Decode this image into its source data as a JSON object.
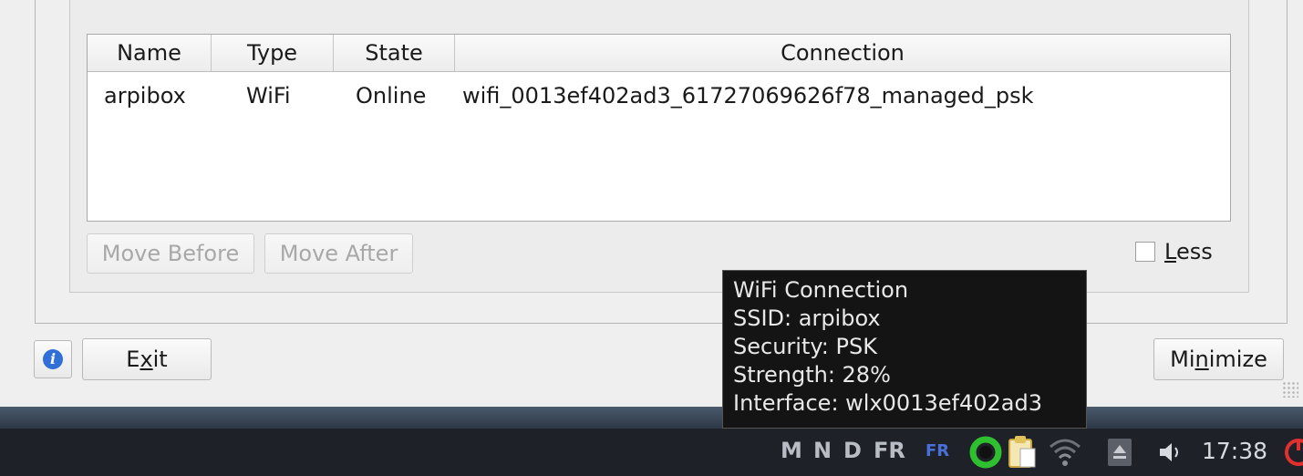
{
  "table": {
    "columns": [
      "Name",
      "Type",
      "State",
      "Connection"
    ],
    "rows": [
      {
        "name": "arpibox",
        "type": "WiFi",
        "state": "Online",
        "connection": "wifi_0013ef402ad3_61727069626f78_managed_psk"
      }
    ]
  },
  "buttons": {
    "move_before": "Move Before",
    "move_after": "Move After",
    "less_label_pre": "",
    "less_label_mnemonic": "L",
    "less_label_post": "ess",
    "less_checked": false,
    "exit_pre": "E",
    "exit_mnemonic": "x",
    "exit_post": "it",
    "minimize_pre": "Mi",
    "minimize_mnemonic": "n",
    "minimize_post": "imize"
  },
  "tooltip": {
    "lines": [
      "WiFi Connection",
      "SSID: arpibox",
      "Security: PSK",
      "Strength: 28%",
      "Interface: wlx0013ef402ad3"
    ]
  },
  "taskbar": {
    "indicators": [
      "M",
      "N",
      "D",
      "FR"
    ],
    "keyboard_layout": "FR",
    "clock": "17:38",
    "icons": [
      "green-ring-icon",
      "clipboard-icon",
      "wifi-icon",
      "eject-icon",
      "volume-icon",
      "shutdown-icon"
    ]
  },
  "colors": {
    "tooltip_bg": "#141414",
    "taskbar_bg": "#1e2127",
    "layout_blue": "#4a6fd8",
    "green": "#2fc02f",
    "red": "#e03030"
  }
}
